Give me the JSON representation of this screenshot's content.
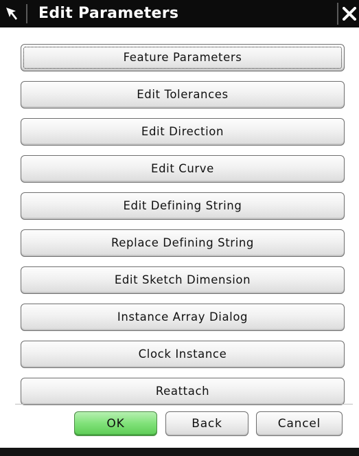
{
  "window": {
    "title": "Edit Parameters"
  },
  "buttons": [
    {
      "label": "Feature Parameters"
    },
    {
      "label": "Edit Tolerances"
    },
    {
      "label": "Edit Direction"
    },
    {
      "label": "Edit Curve"
    },
    {
      "label": "Edit Defining String"
    },
    {
      "label": "Replace Defining String"
    },
    {
      "label": "Edit Sketch Dimension"
    },
    {
      "label": "Instance Array Dialog"
    },
    {
      "label": "Clock Instance"
    },
    {
      "label": "Reattach"
    }
  ],
  "footer": {
    "ok_label": "OK",
    "back_label": "Back",
    "cancel_label": "Cancel"
  },
  "icons": {
    "title_icon": "select-pointer-icon",
    "close_icon": "close-icon"
  },
  "colors": {
    "titlebar": "#0c0c0c",
    "ok_button": "#7fe178"
  }
}
